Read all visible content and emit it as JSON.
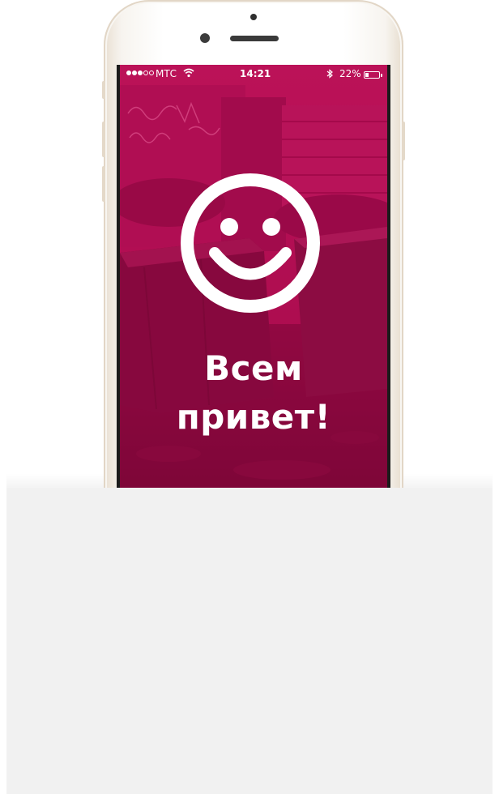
{
  "status_bar": {
    "signal_dots": 3,
    "signal_dots_total": 5,
    "carrier": "МТС",
    "time": "14:21",
    "battery_percent": "22%",
    "battery_level": 0.22,
    "icons": [
      "wifi-icon",
      "bluetooth-icon",
      "battery-icon"
    ]
  },
  "screen": {
    "greeting_line1": "Всем",
    "greeting_line2": "привет!",
    "icon": "smiley-icon",
    "tint_color": "#c40656"
  },
  "device": {
    "color": "gold-white"
  }
}
